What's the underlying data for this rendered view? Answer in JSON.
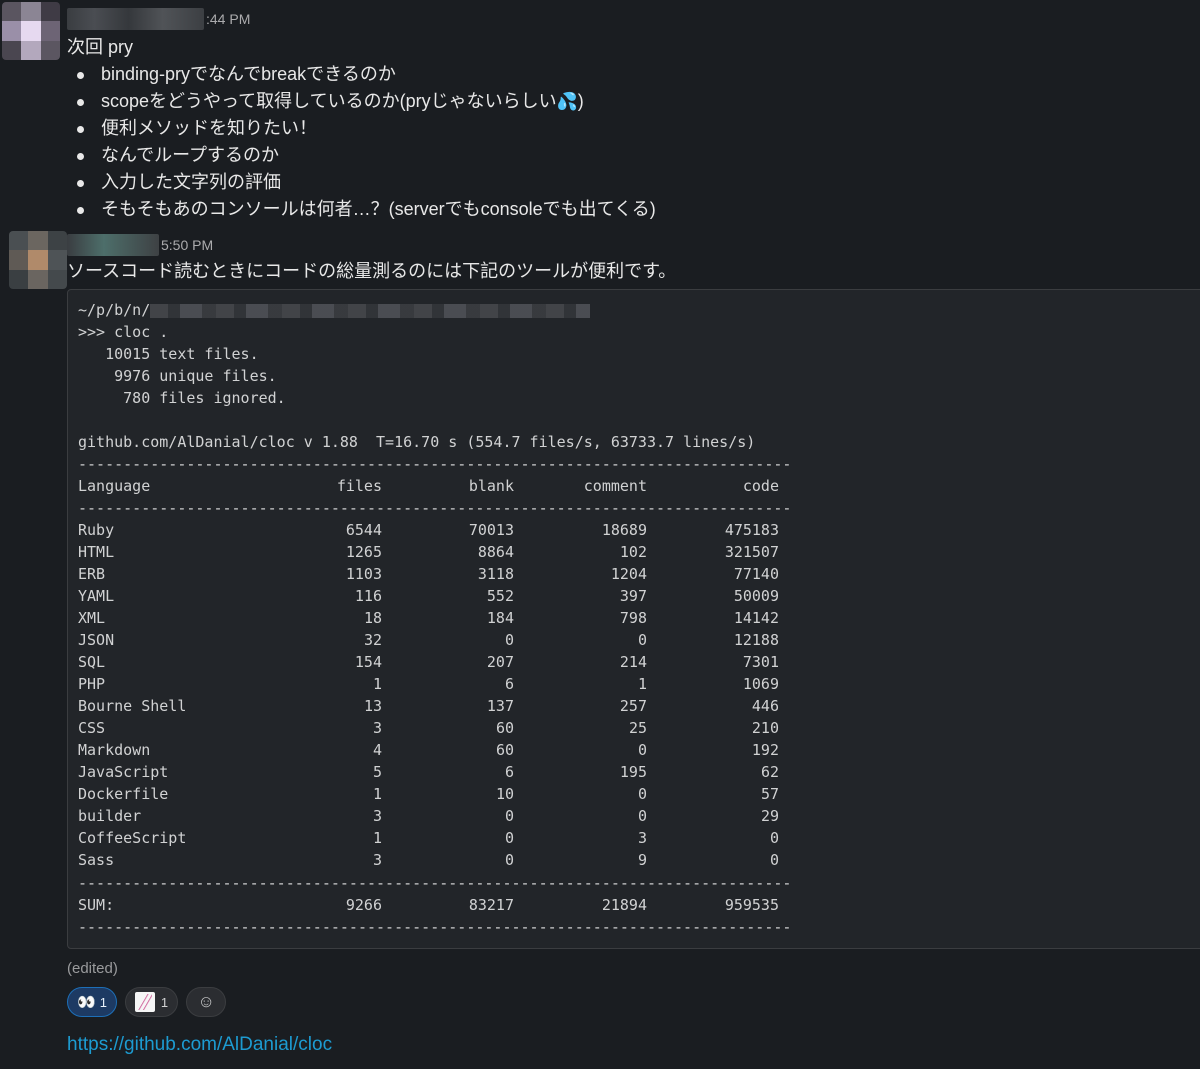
{
  "messages": [
    {
      "time": ":44 PM",
      "title_line": "次回 pry",
      "bullets": [
        "binding-pryでなんでbreakできるのか",
        "scopeをどうやって取得しているのか(pryじゃないらしい",
        "便利メソッドを知りたい！",
        "なんでループするのか",
        "入力した文字列の評価",
        "そもそもあのコンソールは何者…？(serverでもconsoleでも出てくる)"
      ],
      "bullet2_suffix": ")",
      "emoji_icon": "sweat-drops-icon"
    },
    {
      "time": "5:50 PM",
      "text": "ソースコード読むときにコードの総量測るのには下記のツールが便利です。"
    }
  ],
  "code": {
    "path_prefix": "~/p/b/n/",
    "command": ">>> cloc .",
    "summary": [
      "   10015 text files.",
      "    9976 unique files.",
      "     780 files ignored."
    ],
    "header_line": "github.com/AlDanial/cloc v 1.88  T=16.70 s (554.7 files/s, 63733.7 lines/s)",
    "separator": "-------------------------------------------------------------------------------",
    "columns": [
      "Language",
      "files",
      "blank",
      "comment",
      "code"
    ],
    "rows": [
      [
        "Ruby",
        "6544",
        "70013",
        "18689",
        "475183"
      ],
      [
        "HTML",
        "1265",
        "8864",
        "102",
        "321507"
      ],
      [
        "ERB",
        "1103",
        "3118",
        "1204",
        "77140"
      ],
      [
        "YAML",
        "116",
        "552",
        "397",
        "50009"
      ],
      [
        "XML",
        "18",
        "184",
        "798",
        "14142"
      ],
      [
        "JSON",
        "32",
        "0",
        "0",
        "12188"
      ],
      [
        "SQL",
        "154",
        "207",
        "214",
        "7301"
      ],
      [
        "PHP",
        "1",
        "6",
        "1",
        "1069"
      ],
      [
        "Bourne Shell",
        "13",
        "137",
        "257",
        "446"
      ],
      [
        "CSS",
        "3",
        "60",
        "25",
        "210"
      ],
      [
        "Markdown",
        "4",
        "60",
        "0",
        "192"
      ],
      [
        "JavaScript",
        "5",
        "6",
        "195",
        "62"
      ],
      [
        "Dockerfile",
        "1",
        "10",
        "0",
        "57"
      ],
      [
        "builder",
        "3",
        "0",
        "0",
        "29"
      ],
      [
        "CoffeeScript",
        "1",
        "0",
        "3",
        "0"
      ],
      [
        "Sass",
        "3",
        "0",
        "9",
        "0"
      ]
    ],
    "sum": [
      "SUM:",
      "9266",
      "83217",
      "21894",
      "959535"
    ]
  },
  "edited_label": "(edited)",
  "reactions": [
    {
      "icon": "eyes-icon",
      "glyph": "👀",
      "count": "1"
    },
    {
      "icon": "custom-image-icon",
      "count": "1"
    },
    {
      "icon": "add-reaction-icon",
      "glyph": "☺"
    }
  ],
  "link": "https://github.com/AlDanial/cloc",
  "colors": {
    "background": "#1a1d21",
    "link": "#1d9bd1",
    "reaction_active": "#1d3a63"
  }
}
